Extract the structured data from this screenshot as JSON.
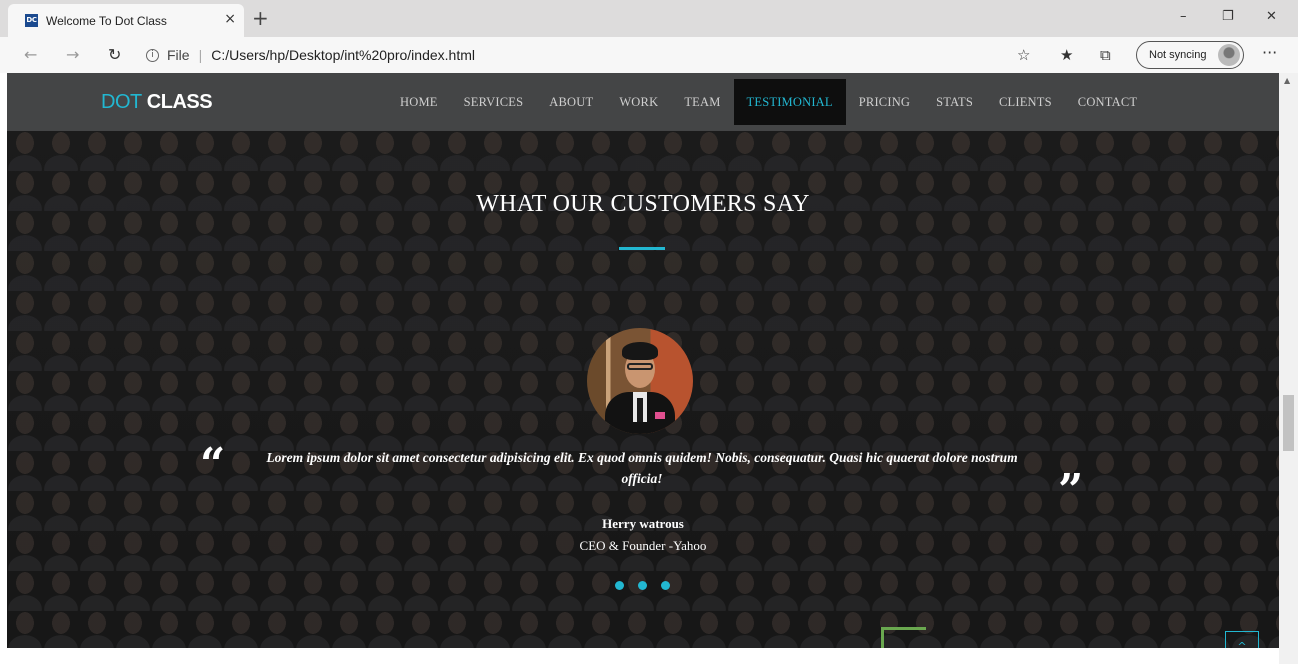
{
  "browser": {
    "tab_favicon": "DC",
    "tab_title": "Welcome To Dot Class",
    "tab_close": "×",
    "new_tab": "+",
    "minimize": "–",
    "restore": "❐",
    "close": "✕",
    "back": "←",
    "forward": "→",
    "reload": "↻",
    "info_icon": "i",
    "scheme": "File",
    "separator": "|",
    "url": "C:/Users/hp/Desktop/int%20pro/index.html",
    "favorite_icon": "☆",
    "favorites_icon": "★",
    "collections_icon": "⧉",
    "sync_label": "Not syncing",
    "more_icon": "···"
  },
  "site": {
    "brand_part1": "DOT",
    "brand_part2": "CLASS",
    "nav": [
      {
        "label": "HOME"
      },
      {
        "label": "SERVICES"
      },
      {
        "label": "ABOUT"
      },
      {
        "label": "WORK"
      },
      {
        "label": "TEAM"
      },
      {
        "label": "TESTIMONIAL",
        "active": true
      },
      {
        "label": "PRICING"
      },
      {
        "label": "STATS"
      },
      {
        "label": "CLIENTS"
      },
      {
        "label": "CONTACT"
      }
    ],
    "accent_color": "#22b7d1"
  },
  "testimonial": {
    "heading": "WHAT OUR CUSTOMERS SAY",
    "quote_open": "“",
    "quote_close": "”",
    "quote": "Lorem ipsum dolor sit amet consectetur adipisicing elit. Ex quod omnis quidem! Nobis, consequatur. Quasi hic quaerat dolore nostrum officia!",
    "author": "Herry watrous",
    "role": "CEO & Founder -Yahoo",
    "slide_count": 3
  },
  "back_to_top": "^",
  "scroll_up": "▲"
}
